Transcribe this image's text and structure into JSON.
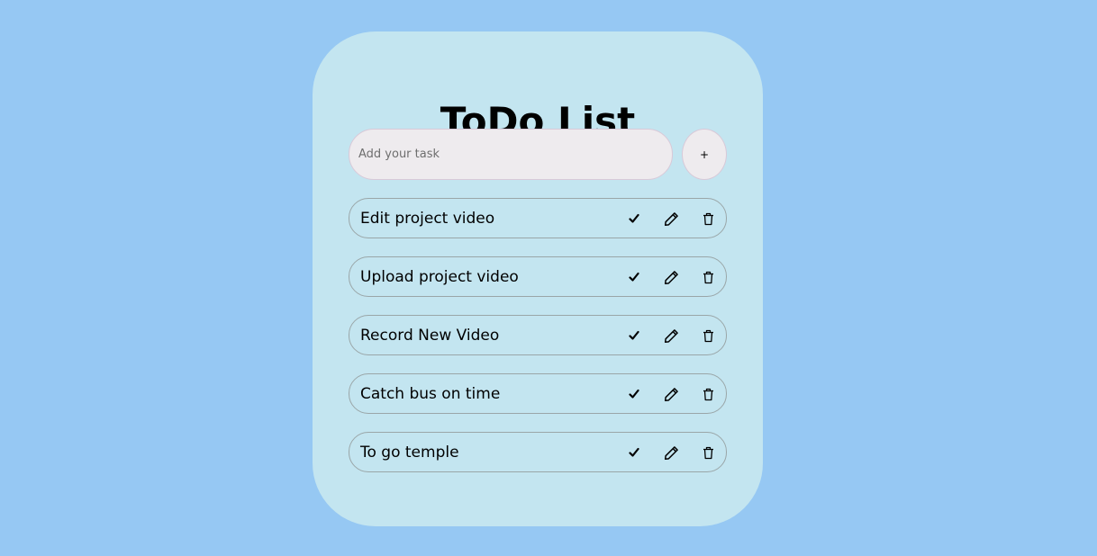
{
  "app": {
    "title": "ToDo List"
  },
  "input": {
    "placeholder": "Add your task",
    "value": "",
    "add_label": "+"
  },
  "tasks": [
    {
      "text": "Edit project video"
    },
    {
      "text": "Upload project video"
    },
    {
      "text": "Record New Video"
    },
    {
      "text": "Catch bus on time"
    },
    {
      "text": "To go temple"
    }
  ],
  "icons": {
    "complete": "check-icon",
    "edit": "pencil-icon",
    "delete": "trash-icon"
  },
  "colors": {
    "background": "#96c8f3",
    "card": "#c3e5f0",
    "input_fill": "#eeebee",
    "task_border": "#9aa6a8"
  }
}
